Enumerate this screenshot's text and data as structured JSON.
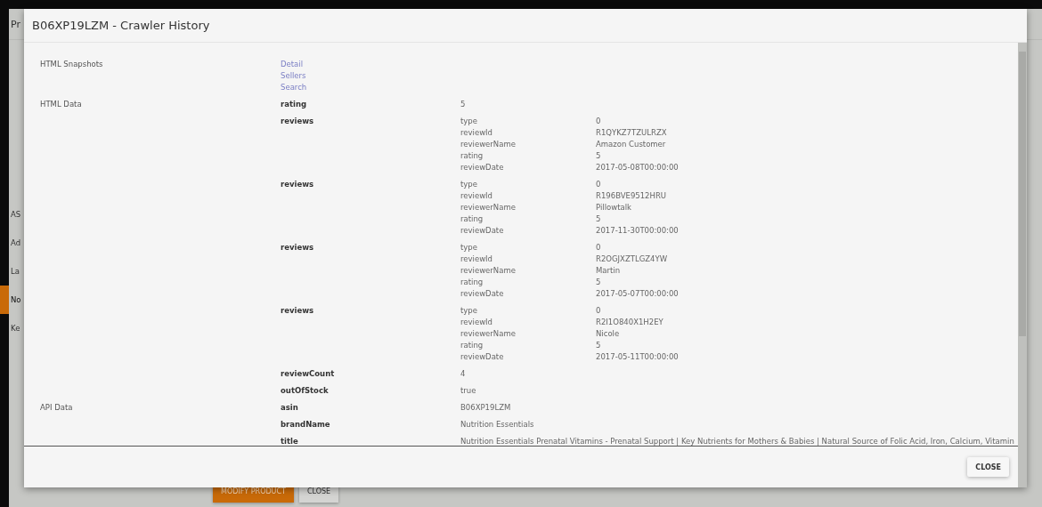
{
  "background_page": {
    "title": "Pr",
    "sidebar": [
      {
        "label": "AS",
        "selected": false
      },
      {
        "label": "Ad",
        "selected": false
      },
      {
        "label": "La",
        "selected": false
      },
      {
        "label": "No",
        "selected": true
      },
      {
        "label": "Ke",
        "selected": false
      }
    ],
    "buttons": [
      {
        "label": "MODIFY PRODUCT",
        "kind": "primary"
      },
      {
        "label": "CLOSE",
        "kind": "secondary"
      }
    ]
  },
  "dialog": {
    "title": "B06XP19LZM - Crawler History",
    "sections": [
      {
        "label": "HTML Snapshots",
        "kind": "links",
        "links": [
          "Detail",
          "Sellers",
          "Search"
        ]
      },
      {
        "label": "HTML Data",
        "kind": "fields",
        "fields": [
          {
            "key": "rating",
            "kind": "value",
            "value": "5"
          },
          {
            "key": "reviews",
            "kind": "object",
            "entries": [
              {
                "key": "type",
                "value": "0"
              },
              {
                "key": "reviewId",
                "value": "R1QYKZ7TZULRZX"
              },
              {
                "key": "reviewerName",
                "value": "Amazon Customer"
              },
              {
                "key": "rating",
                "value": "5"
              },
              {
                "key": "reviewDate",
                "value": "2017-05-08T00:00:00"
              }
            ]
          },
          {
            "key": "reviews",
            "kind": "object",
            "entries": [
              {
                "key": "type",
                "value": "0"
              },
              {
                "key": "reviewId",
                "value": "R196BVE9512HRU"
              },
              {
                "key": "reviewerName",
                "value": "Pillowtalk"
              },
              {
                "key": "rating",
                "value": "5"
              },
              {
                "key": "reviewDate",
                "value": "2017-11-30T00:00:00"
              }
            ]
          },
          {
            "key": "reviews",
            "kind": "object",
            "entries": [
              {
                "key": "type",
                "value": "0"
              },
              {
                "key": "reviewId",
                "value": "R2OGJXZTLGZ4YW"
              },
              {
                "key": "reviewerName",
                "value": "Martin"
              },
              {
                "key": "rating",
                "value": "5"
              },
              {
                "key": "reviewDate",
                "value": "2017-05-07T00:00:00"
              }
            ]
          },
          {
            "key": "reviews",
            "kind": "object",
            "entries": [
              {
                "key": "type",
                "value": "0"
              },
              {
                "key": "reviewId",
                "value": "R2I1O840X1H2EY"
              },
              {
                "key": "reviewerName",
                "value": "Nicole"
              },
              {
                "key": "rating",
                "value": "5"
              },
              {
                "key": "reviewDate",
                "value": "2017-05-11T00:00:00"
              }
            ]
          },
          {
            "key": "reviewCount",
            "kind": "value",
            "value": "4"
          },
          {
            "key": "outOfStock",
            "kind": "value",
            "value": "true"
          }
        ]
      },
      {
        "label": "API Data",
        "kind": "fields",
        "fields": [
          {
            "key": "asin",
            "kind": "value",
            "value": "B06XP19LZM"
          },
          {
            "key": "brandName",
            "kind": "value",
            "value": "Nutrition Essentials"
          },
          {
            "key": "title",
            "kind": "value",
            "value": "Nutrition Essentials Prenatal Vitamins - Prenatal Support | Key Nutrients for Mothers & Babies | Natural Source of Folic Acid, Iron, Calcium, Vitamin"
          }
        ]
      }
    ],
    "close_button": "CLOSE"
  }
}
